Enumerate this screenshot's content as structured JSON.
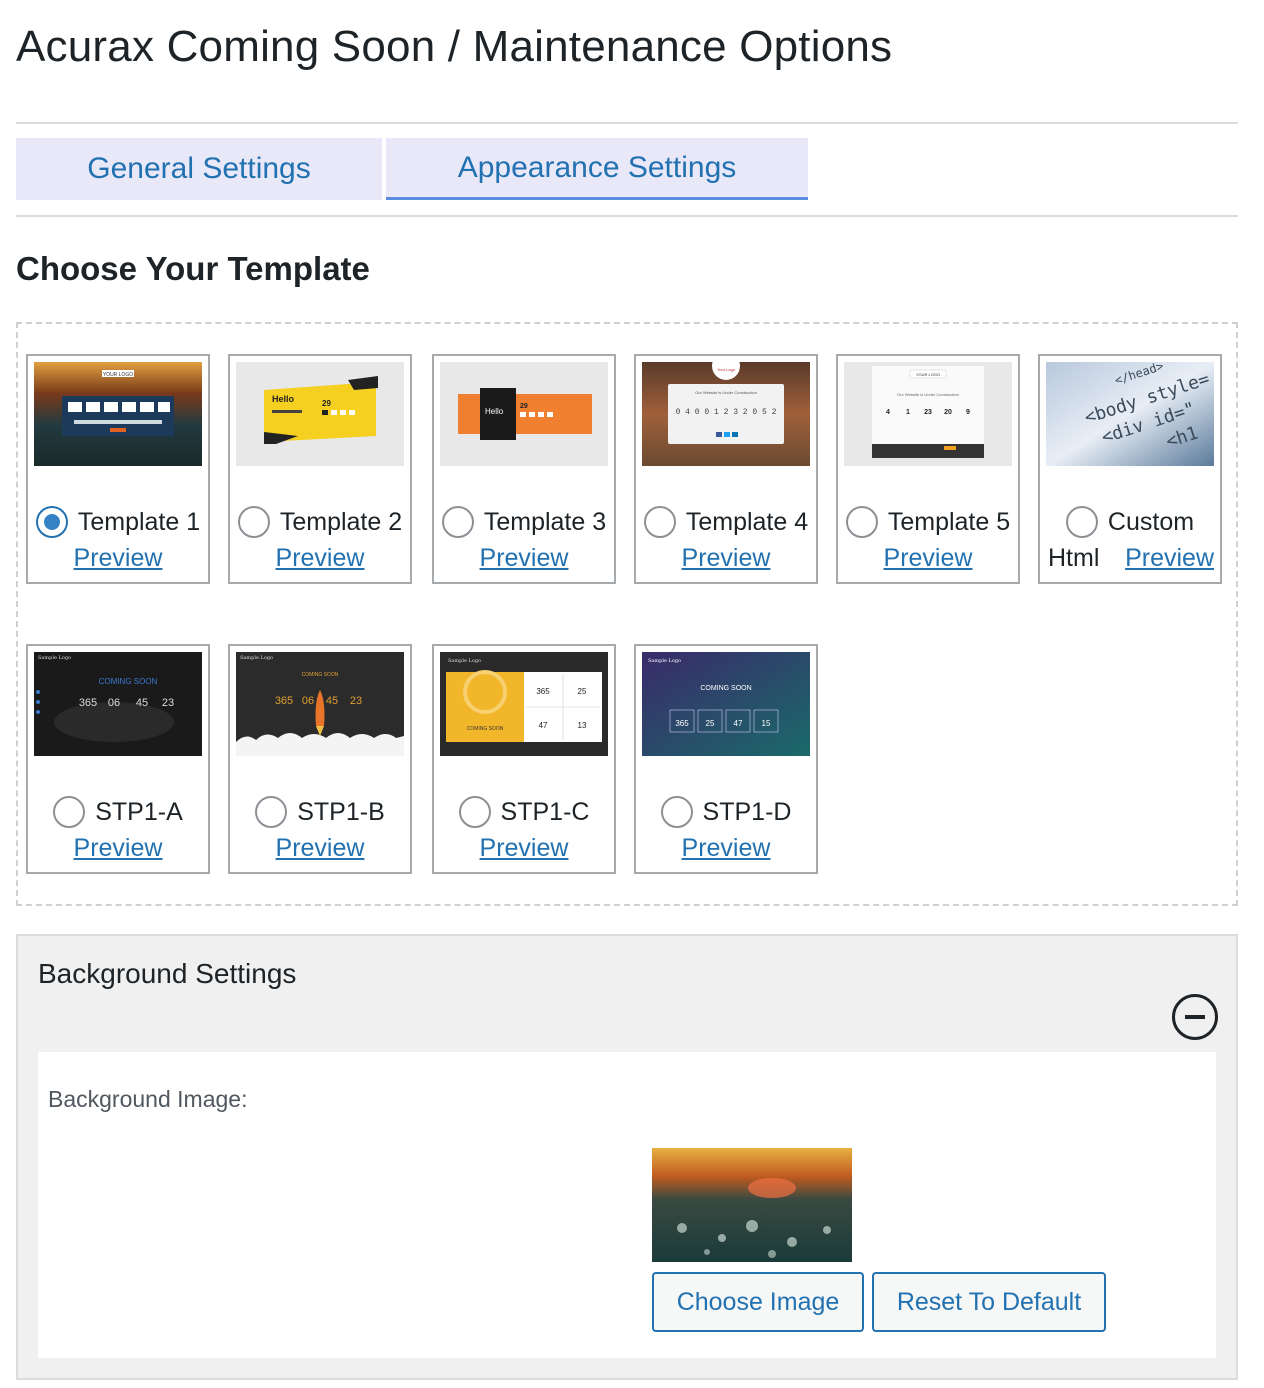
{
  "page": {
    "title": "Acurax Coming Soon / Maintenance Options"
  },
  "tabs": [
    {
      "label": "General Settings",
      "active": false
    },
    {
      "label": "Appearance Settings",
      "active": true
    }
  ],
  "templates_section": {
    "title": "Choose Your Template",
    "preview_label": "Preview",
    "templates": [
      {
        "label": "Template 1",
        "selected": true
      },
      {
        "label": "Template 2",
        "selected": false
      },
      {
        "label": "Template 3",
        "selected": false
      },
      {
        "label": "Template 4",
        "selected": false
      },
      {
        "label": "Template 5",
        "selected": false
      },
      {
        "label_line1": "Custom",
        "label_line2": "Html",
        "selected": false
      },
      {
        "label": "STP1-A",
        "selected": false
      },
      {
        "label": "STP1-B",
        "selected": false
      },
      {
        "label": "STP1-C",
        "selected": false
      },
      {
        "label": "STP1-D",
        "selected": false
      }
    ],
    "thumbnails": {
      "t1": {
        "logo": "YOUR LOGO",
        "digits": [
          "0",
          "0",
          "2",
          "1",
          "2",
          "3"
        ]
      },
      "t2": {
        "heading": "Hello",
        "number": "29",
        "digits": [
          "0",
          "0",
          "0",
          "0"
        ]
      },
      "t3": {
        "heading": "Hello",
        "number": "29",
        "digits": [
          "0",
          "0",
          "0",
          "0"
        ]
      },
      "t4": {
        "logo": "Your Logo",
        "caption": "Our Website is Under Construction",
        "digits": "0 4 0 0 1 2 3 2 0 5 2"
      },
      "t5": {
        "logo": "YOUR LOGO",
        "caption": "Our Website is Under Construction",
        "digits": [
          "4",
          "1",
          "23",
          "20",
          "9"
        ]
      },
      "custom": {
        "code_lines": [
          "</head>",
          "<body style=",
          "<div id=\"",
          "<h1"
        ]
      },
      "stp_a": {
        "logo": "Sample Logo",
        "heading": "COMING SOON",
        "digits": [
          "365",
          "06",
          "45",
          "23"
        ]
      },
      "stp_b": {
        "logo": "Sample Logo",
        "heading": "COMING SOON",
        "digits": [
          "365",
          "06",
          "45",
          "23"
        ]
      },
      "stp_c": {
        "logo": "Sample Logo",
        "heading": "COMING SOON",
        "digits": [
          "365",
          "25",
          "47",
          "13"
        ]
      },
      "stp_d": {
        "logo": "Sample Logo",
        "heading": "COMING SOON",
        "digits": [
          "365",
          "25",
          "47",
          "15"
        ]
      }
    }
  },
  "background": {
    "title": "Background Settings",
    "image_label": "Background Image:",
    "choose_button": "Choose Image",
    "reset_button": "Reset To Default"
  },
  "colors": {
    "link": "#2271b1",
    "tab_bg": "#e8e8f8",
    "radio_checked": "#3582c4"
  }
}
